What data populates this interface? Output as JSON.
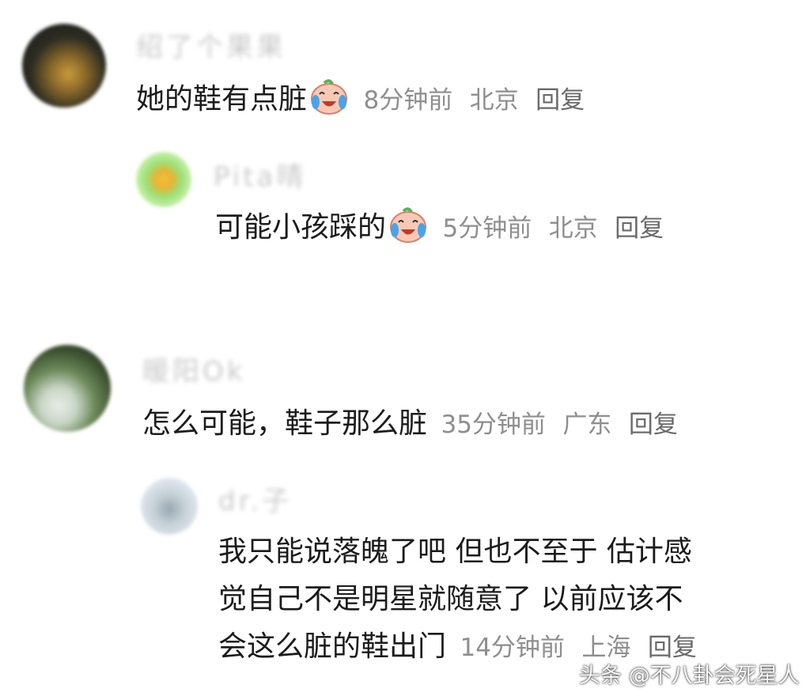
{
  "comments": [
    {
      "username": "绍了个果果",
      "text": "她的鞋有点脏",
      "time": "8分钟前",
      "location": "北京",
      "reply": "回复",
      "emoji": "crying-laughing-icon"
    },
    {
      "username": "Pita晴",
      "text": "可能小孩踩的",
      "time": "5分钟前",
      "location": "北京",
      "reply": "回复",
      "emoji": "crying-laughing-icon"
    },
    {
      "username": "暖阳Ok",
      "text": "怎么可能，鞋子那么脏",
      "time": "35分钟前",
      "location": "广东",
      "reply": "回复"
    },
    {
      "username": "dr.子",
      "text_lines": [
        "我只能说落魄了吧 但也不至于 估计感",
        "觉自己不是明星就随意了 以前应该不",
        "会这么脏的鞋出门"
      ],
      "time": "14分钟前",
      "location": "上海",
      "reply": "回复"
    }
  ],
  "watermark": "头条 @不八卦会死星人",
  "colors": {
    "text": "#1b1b1b",
    "meta": "#8e8e8e",
    "username_blur": "#c9c9c9"
  }
}
